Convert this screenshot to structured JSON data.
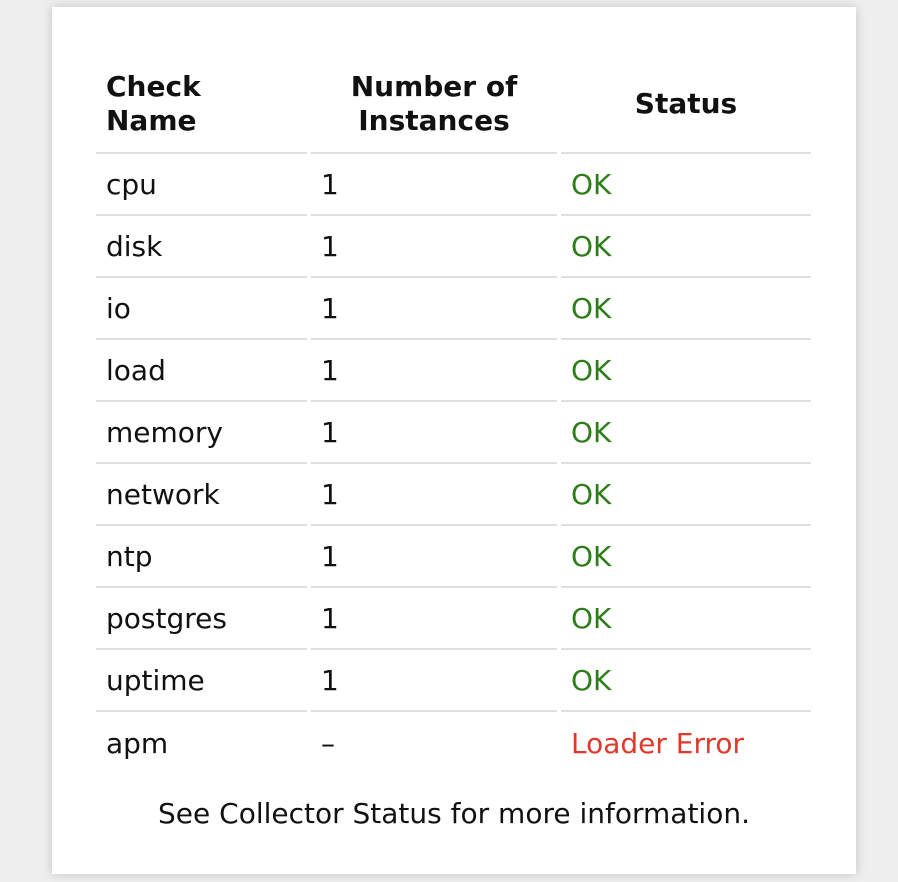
{
  "table": {
    "headers": {
      "name": "Check Name",
      "instances_line1": "Number of",
      "instances_line2": "Instances",
      "status": "Status"
    },
    "rows": [
      {
        "name": "cpu",
        "instances": "1",
        "status": "OK"
      },
      {
        "name": "disk",
        "instances": "1",
        "status": "OK"
      },
      {
        "name": "io",
        "instances": "1",
        "status": "OK"
      },
      {
        "name": "load",
        "instances": "1",
        "status": "OK"
      },
      {
        "name": "memory",
        "instances": "1",
        "status": "OK"
      },
      {
        "name": "network",
        "instances": "1",
        "status": "OK"
      },
      {
        "name": "ntp",
        "instances": "1",
        "status": "OK"
      },
      {
        "name": "postgres",
        "instances": "1",
        "status": "OK"
      },
      {
        "name": "uptime",
        "instances": "1",
        "status": "OK"
      },
      {
        "name": "apm",
        "instances": "–",
        "status": "Loader Error"
      }
    ]
  },
  "footer": {
    "text": "See Collector Status for more information."
  },
  "colors": {
    "ok": "#2e7d1a",
    "error": "#e0392b",
    "divider": "#e0e0e0"
  }
}
